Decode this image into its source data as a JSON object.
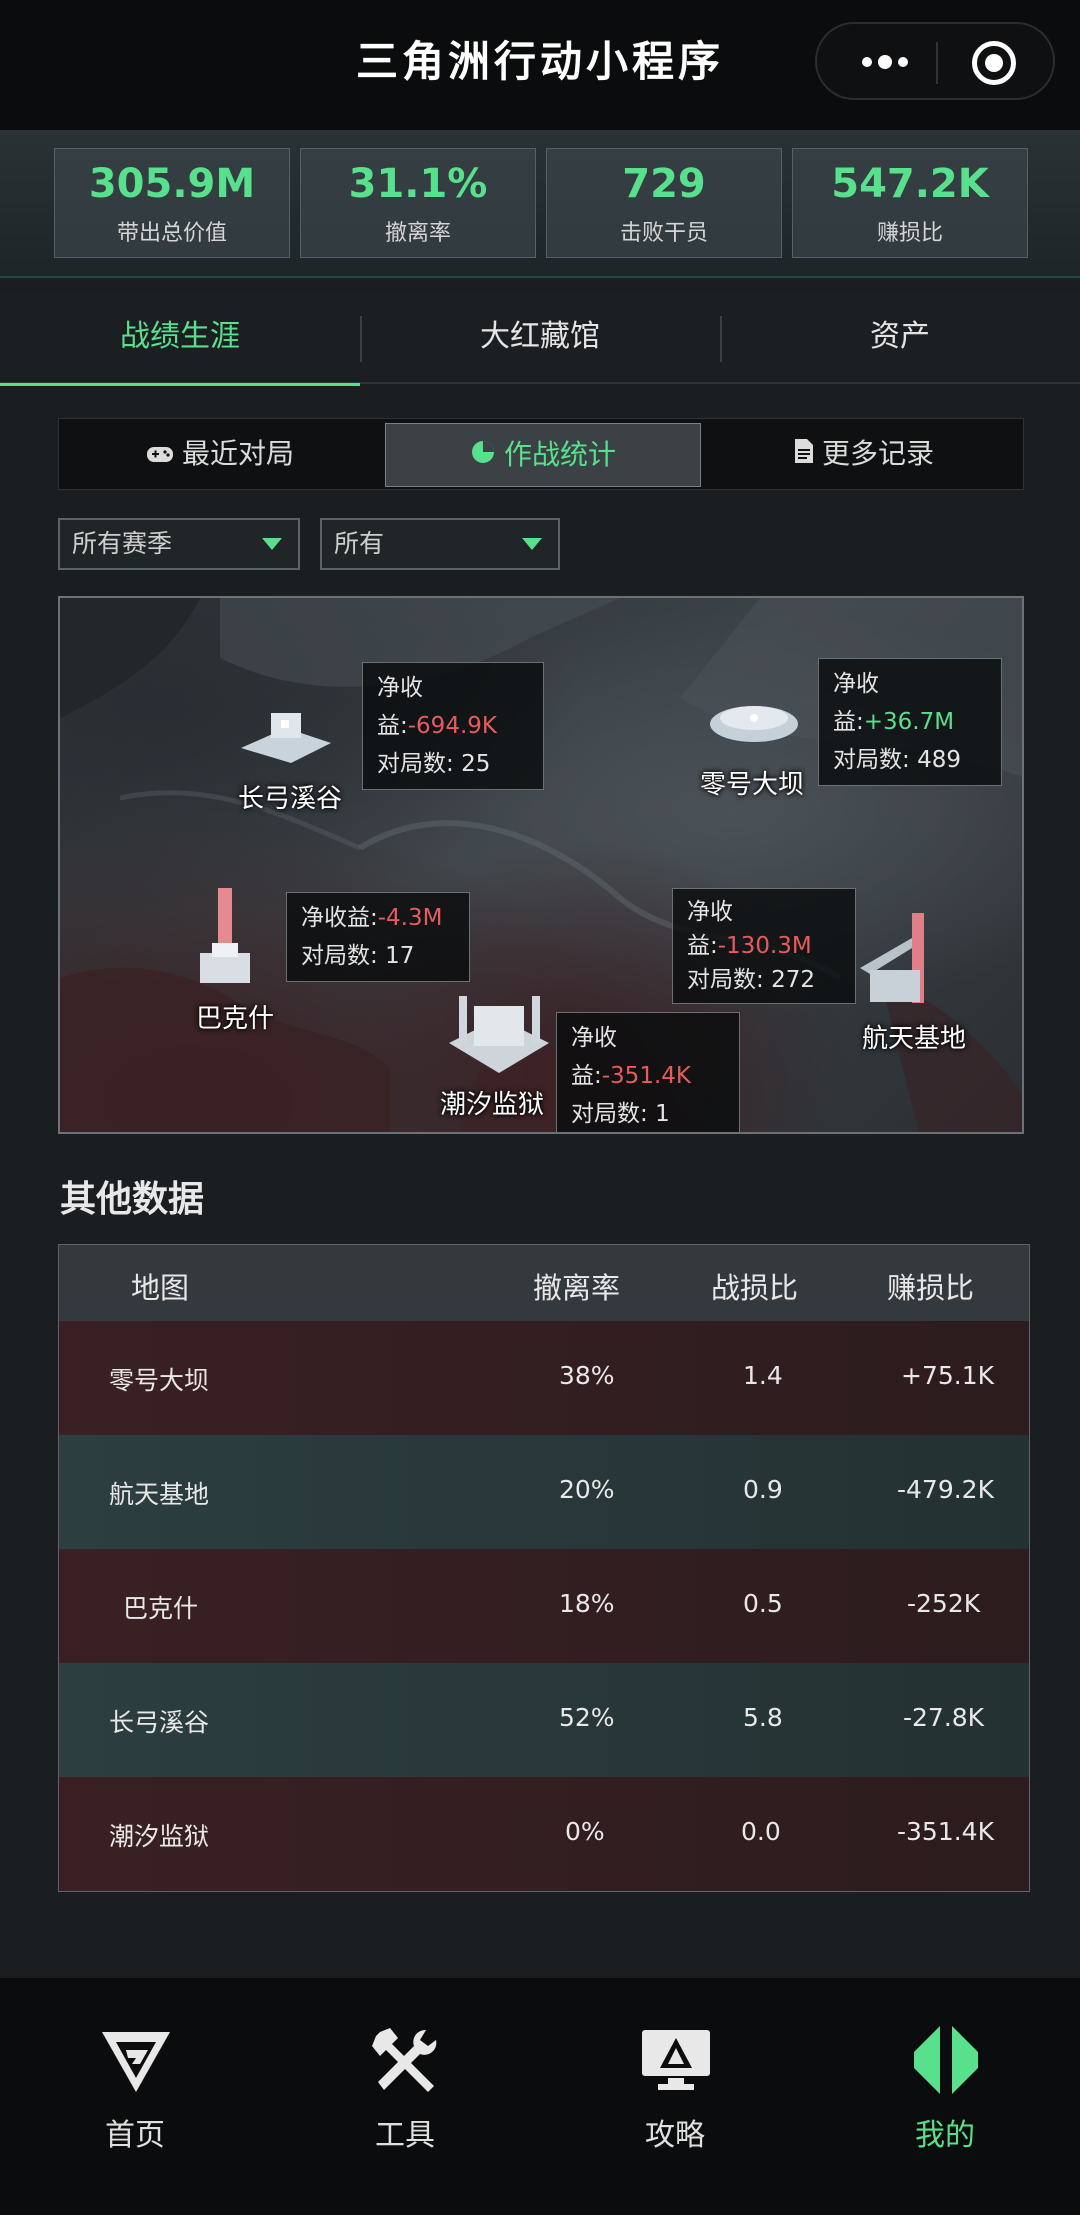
{
  "app": {
    "title": "三角洲行动小程序"
  },
  "stats": [
    {
      "value": "305.9M",
      "label": "带出总价值"
    },
    {
      "value": "31.1%",
      "label": "撤离率"
    },
    {
      "value": "729",
      "label": "击败干员"
    },
    {
      "value": "547.2K",
      "label": "赚损比"
    }
  ],
  "main_tabs": [
    "战绩生涯",
    "大红藏馆",
    "资产"
  ],
  "sub_tabs": [
    "最近对局",
    "作战统计",
    "更多记录"
  ],
  "filters": {
    "season": "所有赛季",
    "mode": "所有"
  },
  "map": {
    "locations": [
      {
        "name": "长弓溪谷",
        "profit_label": "净收益:",
        "profit": "-694.9K",
        "matches_label": "对局数:",
        "matches": "25"
      },
      {
        "name": "零号大坝",
        "profit_label": "净收益:",
        "profit": "+36.7M",
        "matches_label": "对局数:",
        "matches": "489"
      },
      {
        "name": "巴克什",
        "profit_label": "净收益:",
        "profit": "-4.3M",
        "matches_label": "对局数:",
        "matches": "17"
      },
      {
        "name": "航天基地",
        "profit_label": "净收",
        "profit_label2": "益:",
        "profit": "-130.3M",
        "matches_label": "对局数:",
        "matches": "272"
      },
      {
        "name": "潮汐监狱",
        "profit_label": "净收益:",
        "profit": "-351.4K",
        "matches_label": "对局数:",
        "matches": "1"
      }
    ]
  },
  "other": {
    "title": "其他数据",
    "headers": [
      "地图",
      "撤离率",
      "战损比",
      "赚损比"
    ],
    "rows": [
      [
        "零号大坝",
        "38%",
        "1.4",
        "+75.1K"
      ],
      [
        "航天基地",
        "20%",
        "0.9",
        "-479.2K"
      ],
      [
        "巴克什",
        "18%",
        "0.5",
        "-252K"
      ],
      [
        "长弓溪谷",
        "52%",
        "5.8",
        "-27.8K"
      ],
      [
        "潮汐监狱",
        "0%",
        "0.0",
        "-351.4K"
      ]
    ]
  },
  "nav": [
    "首页",
    "工具",
    "攻略",
    "我的"
  ],
  "colors": {
    "accent": "#58e08c",
    "negative": "#e85b5b",
    "background": "#1a1e21"
  }
}
